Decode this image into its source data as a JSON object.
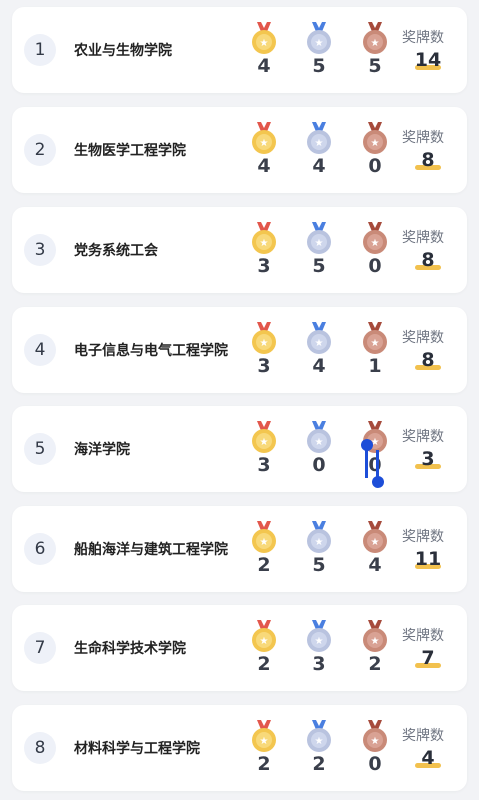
{
  "colors": {
    "gold": "#f3c64f",
    "silver": "#b9c3df",
    "bronze": "#c98a78",
    "total_bar": "#f2c14e",
    "selection": "#1d4ed8"
  },
  "total_label": "奖牌数",
  "rows": [
    {
      "rank": "1",
      "name": "农业与生物学院",
      "gold": "4",
      "silver": "5",
      "bronze": "5",
      "total": "14"
    },
    {
      "rank": "2",
      "name": "生物医学工程学院",
      "gold": "4",
      "silver": "4",
      "bronze": "0",
      "total": "8"
    },
    {
      "rank": "3",
      "name": "党务系统工会",
      "gold": "3",
      "silver": "5",
      "bronze": "0",
      "total": "8"
    },
    {
      "rank": "4",
      "name": "电子信息与电气工程学院",
      "gold": "3",
      "silver": "4",
      "bronze": "1",
      "total": "8"
    },
    {
      "rank": "5",
      "name": "海洋学院",
      "gold": "3",
      "silver": "0",
      "bronze": "0",
      "total": "3"
    },
    {
      "rank": "6",
      "name": "船舶海洋与建筑工程学院",
      "gold": "2",
      "silver": "5",
      "bronze": "4",
      "total": "11"
    },
    {
      "rank": "7",
      "name": "生命科学技术学院",
      "gold": "2",
      "silver": "3",
      "bronze": "2",
      "total": "7"
    },
    {
      "rank": "8",
      "name": "材料科学与工程学院",
      "gold": "2",
      "silver": "2",
      "bronze": "0",
      "total": "4"
    }
  ]
}
